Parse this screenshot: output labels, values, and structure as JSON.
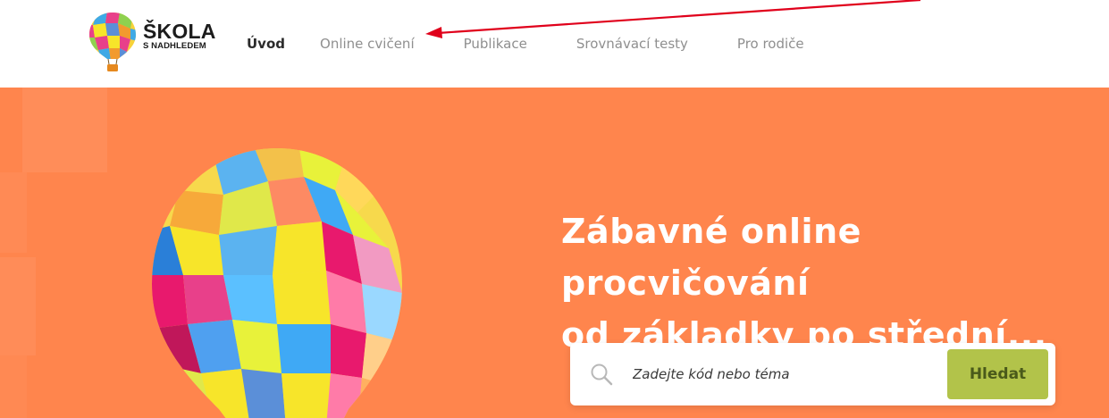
{
  "brand": {
    "name_main": "ŠKOLA",
    "name_sub": "S NADHLEDEM",
    "accent_color": "#ff854d",
    "button_color": "#b2c34a",
    "annotation_color": "#e0001b"
  },
  "nav": {
    "items": [
      {
        "label": "Úvod",
        "active": true
      },
      {
        "label": "Online cvičení",
        "active": false
      },
      {
        "label": "Publikace",
        "active": false
      },
      {
        "label": "Srovnávací testy",
        "active": false
      },
      {
        "label": "Pro rodiče",
        "active": false
      }
    ]
  },
  "hero": {
    "title_line1": "Zábavné online procvičování",
    "title_line2": "od základky po střední..."
  },
  "search": {
    "placeholder": "Zadejte kód nebo téma",
    "value": "",
    "button_label": "Hledat",
    "icon": "search-icon"
  },
  "annotation": {
    "type": "arrow",
    "points_to": "Online cvičení"
  }
}
